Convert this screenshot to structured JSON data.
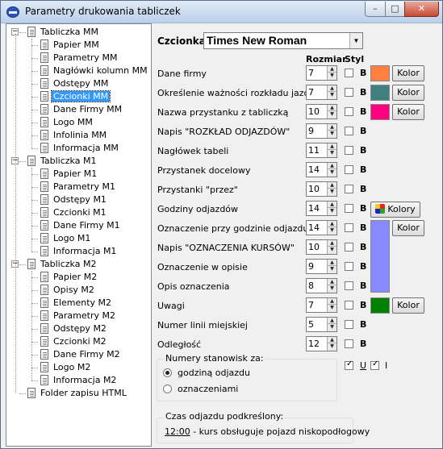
{
  "window": {
    "title": "Parametry drukowania tabliczek"
  },
  "tree": {
    "groups": [
      {
        "label": "Tabliczka MM",
        "children": [
          "Papier MM",
          "Parametry MM",
          "Nagłówki kolumn MM",
          "Odstępy MM",
          "Czcionki MM",
          "Dane Firmy MM",
          "Logo MM",
          "Infolinia MM",
          "Informacja MM"
        ]
      },
      {
        "label": "Tabliczka M1",
        "children": [
          "Papier M1",
          "Parametry M1",
          "Odstępy M1",
          "Czcionki M1",
          "Dane Firmy M1",
          "Logo M1",
          "Informacja M1"
        ]
      },
      {
        "label": "Tabliczka M2",
        "children": [
          "Papier M2",
          "Opisy M2",
          "Elementy M2",
          "Parametry M2",
          "Odstępy M2",
          "Czcionki M2",
          "Dane Firmy M2",
          "Logo M2",
          "Informacja M2"
        ]
      }
    ],
    "footer_item": "Folder zapisu HTML",
    "selected": "Czcionki MM"
  },
  "font": {
    "label": "Czcionka",
    "value": "Times New Roman"
  },
  "columns": {
    "size": "Rozmiar",
    "style": "Styl"
  },
  "bold_label": "B",
  "color_button": "Kolor",
  "colors_button": "Kolory",
  "rows": [
    {
      "label": "Dane firmy",
      "size": "7",
      "color": "#ff8040"
    },
    {
      "label": "Określenie ważności rozkładu jazdy",
      "size": "7",
      "color": "#408080"
    },
    {
      "label": "Nazwa przystanku z tabliczką",
      "size": "10",
      "color": "#ff0080"
    },
    {
      "label": "Napis \"ROZKŁAD ODJAZDÓW\"",
      "size": "9"
    },
    {
      "label": "Nagłówek tabeli",
      "size": "11"
    },
    {
      "label": "Przystanek docelowy",
      "size": "14"
    },
    {
      "label": "Przystanki \"przez\"",
      "size": "10"
    },
    {
      "label": "Godziny odjazdów",
      "size": "14"
    },
    {
      "label": "Oznaczenie przy godzinie odjazdu",
      "size": "14"
    },
    {
      "label": "Napis \"OZNACZENIA KURSÓW\"",
      "size": "10"
    },
    {
      "label": "Oznaczenie w opisie",
      "size": "9"
    },
    {
      "label": "Opis oznaczenia",
      "size": "8"
    },
    {
      "label": "Uwagi",
      "size": "7",
      "color": "#008000"
    },
    {
      "label": "Numer linii miejskiej",
      "size": "5"
    },
    {
      "label": "Odległość",
      "size": "12"
    }
  ],
  "marker_color": "#8888ff",
  "stations": {
    "title": "Numery stanowisk za:",
    "options": [
      "godziną odjazdu",
      "oznaczeniami"
    ],
    "selected": "godziną odjazdu",
    "underline_label": "U",
    "italic_label": "I"
  },
  "underlined": {
    "title": "Czas odjazdu podkreślony:",
    "time": "12:00",
    "text": " - kurs obsługuje pojazd niskopodłogowy"
  }
}
